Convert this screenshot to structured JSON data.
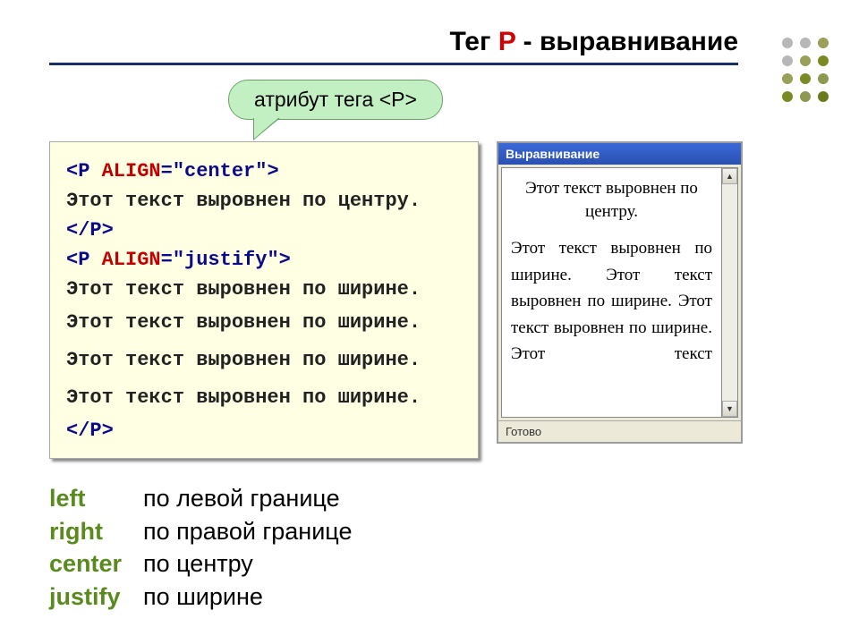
{
  "title": {
    "before": "Тег ",
    "tag": "P",
    "after": " - выравнивание"
  },
  "callout": "атрибут тега <P>",
  "code": {
    "l1a": "<P ",
    "l1b": "ALIGN",
    "l1c": "=\"center\">",
    "l2": "Этот текст выровнен по центру.",
    "l3": "</P>",
    "l4a": "<P ",
    "l4b": "ALIGN",
    "l4c": "=\"justify\">",
    "l5": "Этот текст выровнен по ширине.",
    "l6": "Этот текст выровнен по ширине.",
    "l7": "Этот текст выровнен по ширине.",
    "l8": "Этот текст выровнен по ширине.",
    "l9": "</P>"
  },
  "window": {
    "title": "Выравнивание",
    "centered": "Этот текст выровнен по центру.",
    "justify": "Этот текст выровнен по ширине. Этот текст выровнен по ширине. Этот текст выровнен по ширине. Этот текст",
    "status": "Готово"
  },
  "aligns": {
    "left": {
      "kw": "left",
      "desc": "по левой границе"
    },
    "right": {
      "kw": "right",
      "desc": "по правой границе"
    },
    "center": {
      "kw": "center",
      "desc": "по центру"
    },
    "justify": {
      "kw": "justify",
      "desc": "по ширине"
    }
  }
}
